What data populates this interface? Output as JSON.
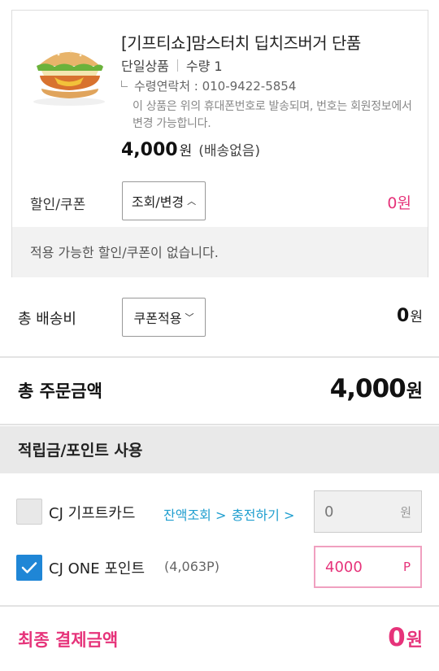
{
  "product": {
    "title": "[기프티쇼]맘스터치 딥치즈버거 단품",
    "type": "단일상품",
    "quantity": "수량 1",
    "contact": "수령연락처 : 010-9422-5854",
    "note": "이 상품은 위의 휴대폰번호로 발송되며, 번호는 회원정보에서 변경 가능합니다.",
    "price": "4,000",
    "price_unit": "원",
    "shipping_note": "(배송없음)",
    "image_icon": "burger-image"
  },
  "coupon": {
    "label": "할인/쿠폰",
    "button": "조회/변경",
    "amount": "0원",
    "empty_message": "적용 가능한 할인/쿠폰이 없습니다."
  },
  "shipping": {
    "label": "총 배송비",
    "button": "쿠폰적용",
    "amount": "0",
    "unit": "원"
  },
  "total": {
    "label": "총 주문금액",
    "amount": "4,000",
    "unit": "원"
  },
  "points": {
    "header": "적립금/포인트 사용",
    "gift_card": {
      "label": "CJ 기프트카드",
      "checked": false,
      "balance_link": "잔액조회 >",
      "charge_link": "충전하기 >",
      "value": "0",
      "unit": "원"
    },
    "cj_one": {
      "label": "CJ ONE 포인트",
      "balance": "(4,063P)",
      "checked": true,
      "value": "4000",
      "unit": "P"
    }
  },
  "final": {
    "label": "최종 결제금액",
    "amount": "0",
    "unit": "원"
  },
  "colors": {
    "accent_pink": "#e6337a",
    "link_blue": "#1f9ecf",
    "checkbox_blue": "#1f86d6"
  }
}
